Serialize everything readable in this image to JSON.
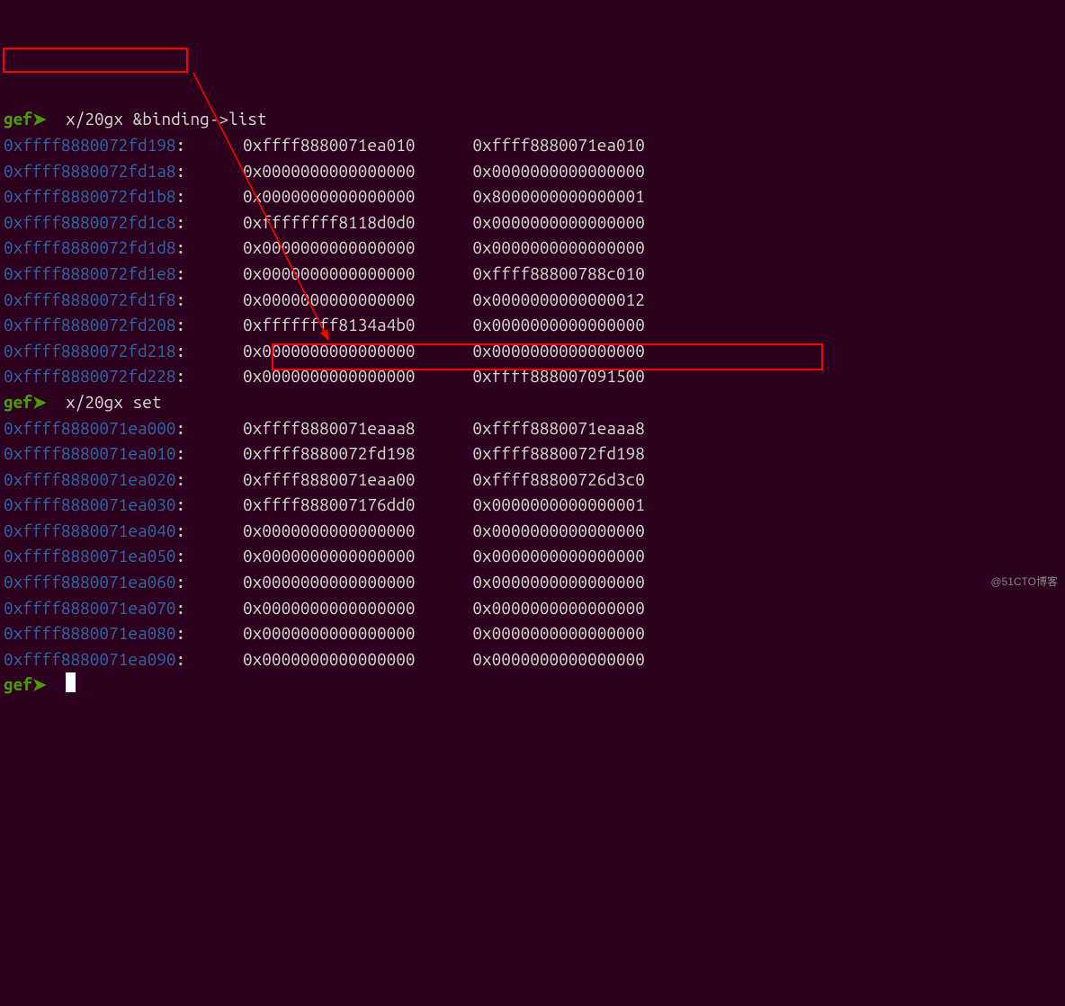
{
  "prompt": "gef➤",
  "cmd1": "x/20gx &binding->list",
  "cmd2": "x/20gx set",
  "watermark": "@51CTO博客",
  "dump1": [
    {
      "addr": "0xffff8880072fd198",
      "v1": "0xffff8880071ea010",
      "v2": "0xffff8880071ea010"
    },
    {
      "addr": "0xffff8880072fd1a8",
      "v1": "0x0000000000000000",
      "v2": "0x0000000000000000"
    },
    {
      "addr": "0xffff8880072fd1b8",
      "v1": "0x0000000000000000",
      "v2": "0x8000000000000001"
    },
    {
      "addr": "0xffff8880072fd1c8",
      "v1": "0xffffffff8118d0d0",
      "v2": "0x0000000000000000"
    },
    {
      "addr": "0xffff8880072fd1d8",
      "v1": "0x0000000000000000",
      "v2": "0x0000000000000000"
    },
    {
      "addr": "0xffff8880072fd1e8",
      "v1": "0x0000000000000000",
      "v2": "0xffff88800788c010"
    },
    {
      "addr": "0xffff8880072fd1f8",
      "v1": "0x0000000000000000",
      "v2": "0x0000000000000012"
    },
    {
      "addr": "0xffff8880072fd208",
      "v1": "0xffffffff8134a4b0",
      "v2": "0x0000000000000000"
    },
    {
      "addr": "0xffff8880072fd218",
      "v1": "0x0000000000000000",
      "v2": "0x0000000000000000"
    },
    {
      "addr": "0xffff8880072fd228",
      "v1": "0x0000000000000000",
      "v2": "0xffff888007091500"
    }
  ],
  "dump2": [
    {
      "addr": "0xffff8880071ea000",
      "v1": "0xffff8880071eaaa8",
      "v2": "0xffff8880071eaaa8"
    },
    {
      "addr": "0xffff8880071ea010",
      "v1": "0xffff8880072fd198",
      "v2": "0xffff8880072fd198"
    },
    {
      "addr": "0xffff8880071ea020",
      "v1": "0xffff8880071eaa00",
      "v2": "0xffff88800726d3c0"
    },
    {
      "addr": "0xffff8880071ea030",
      "v1": "0xffff888007176dd0",
      "v2": "0x0000000000000001"
    },
    {
      "addr": "0xffff8880071ea040",
      "v1": "0x0000000000000000",
      "v2": "0x0000000000000000"
    },
    {
      "addr": "0xffff8880071ea050",
      "v1": "0x0000000000000000",
      "v2": "0x0000000000000000"
    },
    {
      "addr": "0xffff8880071ea060",
      "v1": "0x0000000000000000",
      "v2": "0x0000000000000000"
    },
    {
      "addr": "0xffff8880071ea070",
      "v1": "0x0000000000000000",
      "v2": "0x0000000000000000"
    },
    {
      "addr": "0xffff8880071ea080",
      "v1": "0x0000000000000000",
      "v2": "0x0000000000000000"
    },
    {
      "addr": "0xffff8880071ea090",
      "v1": "0x0000000000000000",
      "v2": "0x0000000000000000"
    }
  ]
}
